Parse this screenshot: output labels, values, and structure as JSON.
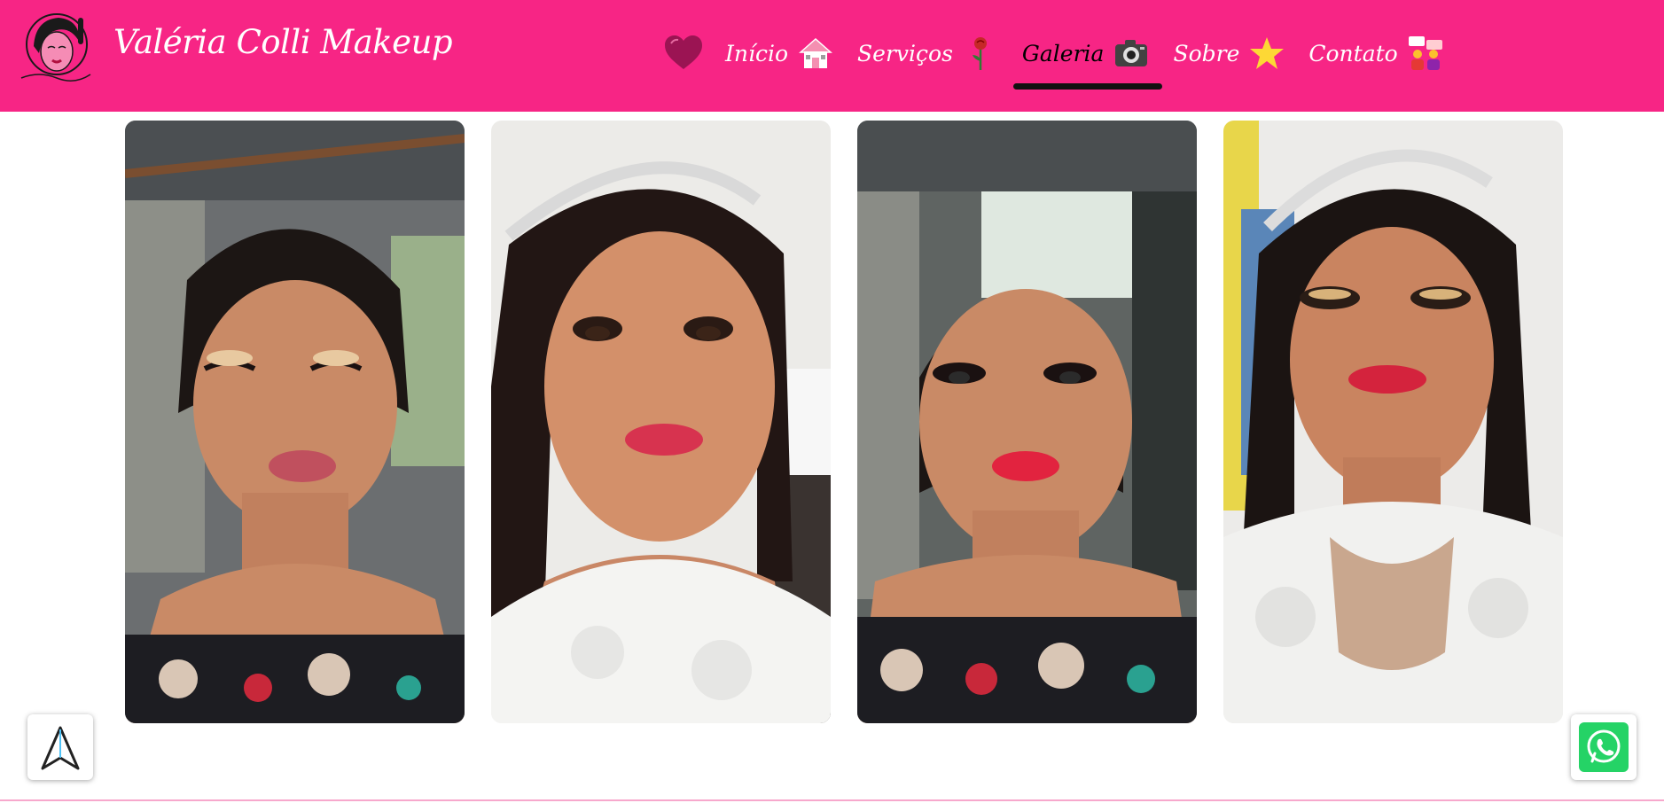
{
  "header": {
    "brand": "Valéria Colli Makeup",
    "logo_text": "Valéria Colli Makeup",
    "background_color": "#f72585"
  },
  "nav": {
    "items": [
      {
        "label": "Início",
        "icon": "house-icon"
      },
      {
        "label": "Serviços",
        "icon": "rose-icon"
      },
      {
        "label": "Galeria",
        "icon": "camera-icon",
        "active": true
      },
      {
        "label": "Sobre",
        "icon": "star-icon"
      },
      {
        "label": "Contato",
        "icon": "people-chat-icon"
      }
    ],
    "decor_icon": "heart-icon",
    "active_indicator_color": "#111111"
  },
  "gallery": {
    "photos": [
      {
        "subject": "makeup-photo-floral-dress"
      },
      {
        "subject": "makeup-photo-white-dress-tiara"
      },
      {
        "subject": "makeup-photo-floral-dress-smile"
      },
      {
        "subject": "makeup-photo-lace-dress-tiara"
      }
    ]
  },
  "floating": {
    "scroll_top_icon": "arrow-up-icon",
    "whatsapp_icon": "whatsapp-icon",
    "whatsapp_color": "#25d366"
  }
}
